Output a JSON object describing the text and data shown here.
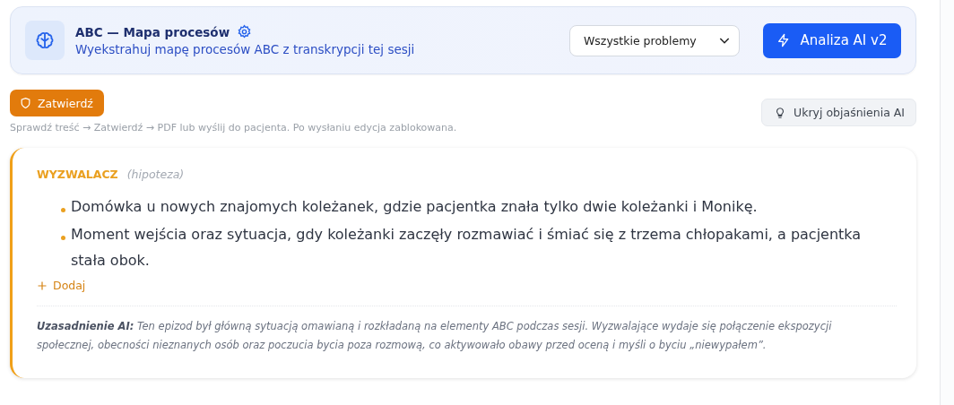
{
  "header": {
    "title": "ABC — Mapa procesów",
    "subtitle": "Wyekstrahuj mapę procesów ABC z transkrypcji tej sesji",
    "filter": {
      "value": "Wszystkie problemy"
    },
    "analyze_button": "Analiza AI v2"
  },
  "approve_button": "Zatwierdź",
  "hint": "Sprawdź treść → Zatwierdź → PDF lub wyślij do pacjenta. Po wysłaniu edycja zablokowana.",
  "toggle_button": "Ukryj objaśnienia AI",
  "section": {
    "title": "WYZWALACZ",
    "tag": "(hipoteza)",
    "items": [
      "Domówka u nowych znajomych koleżanek, gdzie pacjentka znała tylko dwie koleżanki i Monikę.",
      "Moment wejścia oraz sytuacja, gdy koleżanki zaczęły rozmawiać i śmiać się z trzema chłopakami, a pacjentka stała obok."
    ],
    "add_button": "Dodaj",
    "explanation": "**Uzasadnienie AI:** Ten epizod był główną sytuacją omawianą i rozkładaną na elementy ABC podczas sesji. Wyzwalające wydaje się połączenie ekspozycji społecznej, obecności nieznanych osób oraz poczucia bycia poza rozmową, co aktywowało obawy przed oceną i myśli o byciu „niewypałem”."
  }
}
